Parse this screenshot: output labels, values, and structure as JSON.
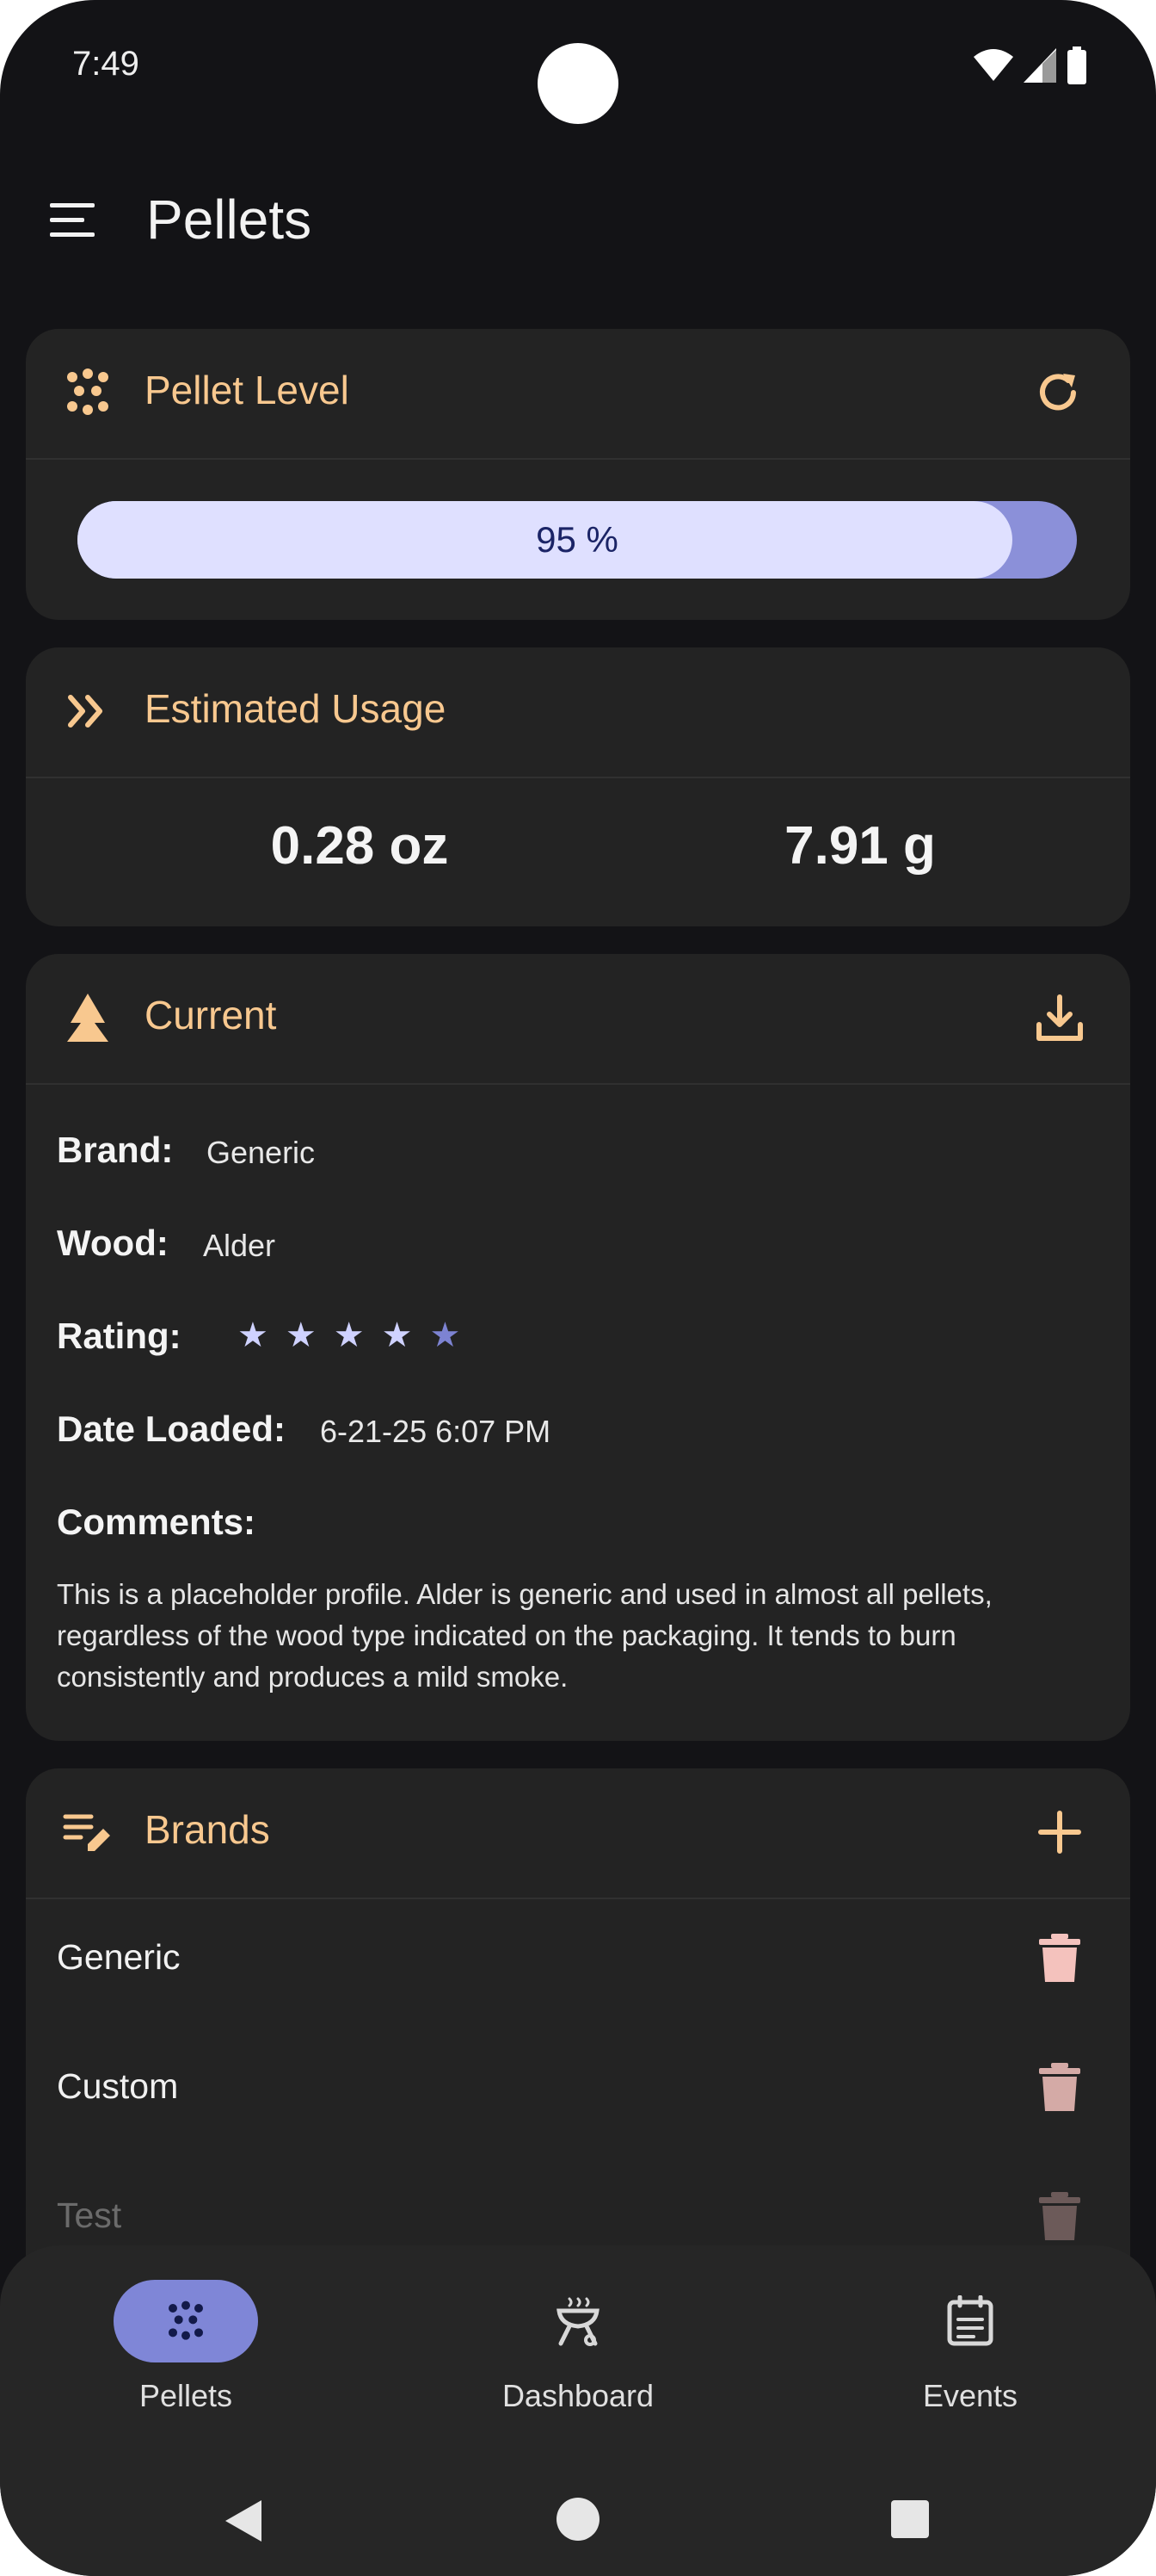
{
  "status_bar": {
    "time": "7:49"
  },
  "app_bar": {
    "title": "Pellets"
  },
  "pellet_level": {
    "title": "Pellet Level",
    "percent_label": "95 %",
    "level_fraction": 0.95
  },
  "estimated_usage": {
    "title": "Estimated Usage",
    "ounces": "0.28 oz",
    "grams": "7.91 g"
  },
  "current": {
    "title": "Current",
    "brand_label": "Brand:",
    "brand_value": "Generic",
    "wood_label": "Wood:",
    "wood_value": "Alder",
    "rating_label": "Rating:",
    "rating_stars": 4,
    "rating_max": 5,
    "date_label": "Date Loaded:",
    "date_value": "6-21-25 6:07 PM",
    "comments_label": "Comments:",
    "comments_text": "This is a placeholder profile.  Alder is generic and used in almost all pellets, regardless of the wood type indicated on the packaging.  It tends to burn consistently and produces a mild smoke."
  },
  "brands": {
    "title": "Brands",
    "items": [
      {
        "name": "Generic"
      },
      {
        "name": "Custom"
      },
      {
        "name": "Test"
      }
    ]
  },
  "bottom_nav": {
    "items": [
      {
        "label": "Pellets",
        "icon": "pellets-icon",
        "active": true
      },
      {
        "label": "Dashboard",
        "icon": "grill-icon",
        "active": false
      },
      {
        "label": "Events",
        "icon": "calendar-icon",
        "active": false
      }
    ]
  },
  "colors": {
    "background": "#131316",
    "card": "#232323",
    "accent_orange": "#f8c88f",
    "progress_track": "#8b90d9",
    "progress_fill": "#dfe0ff",
    "nav_active": "#7f86d7",
    "trash": "#f4c2bd"
  }
}
